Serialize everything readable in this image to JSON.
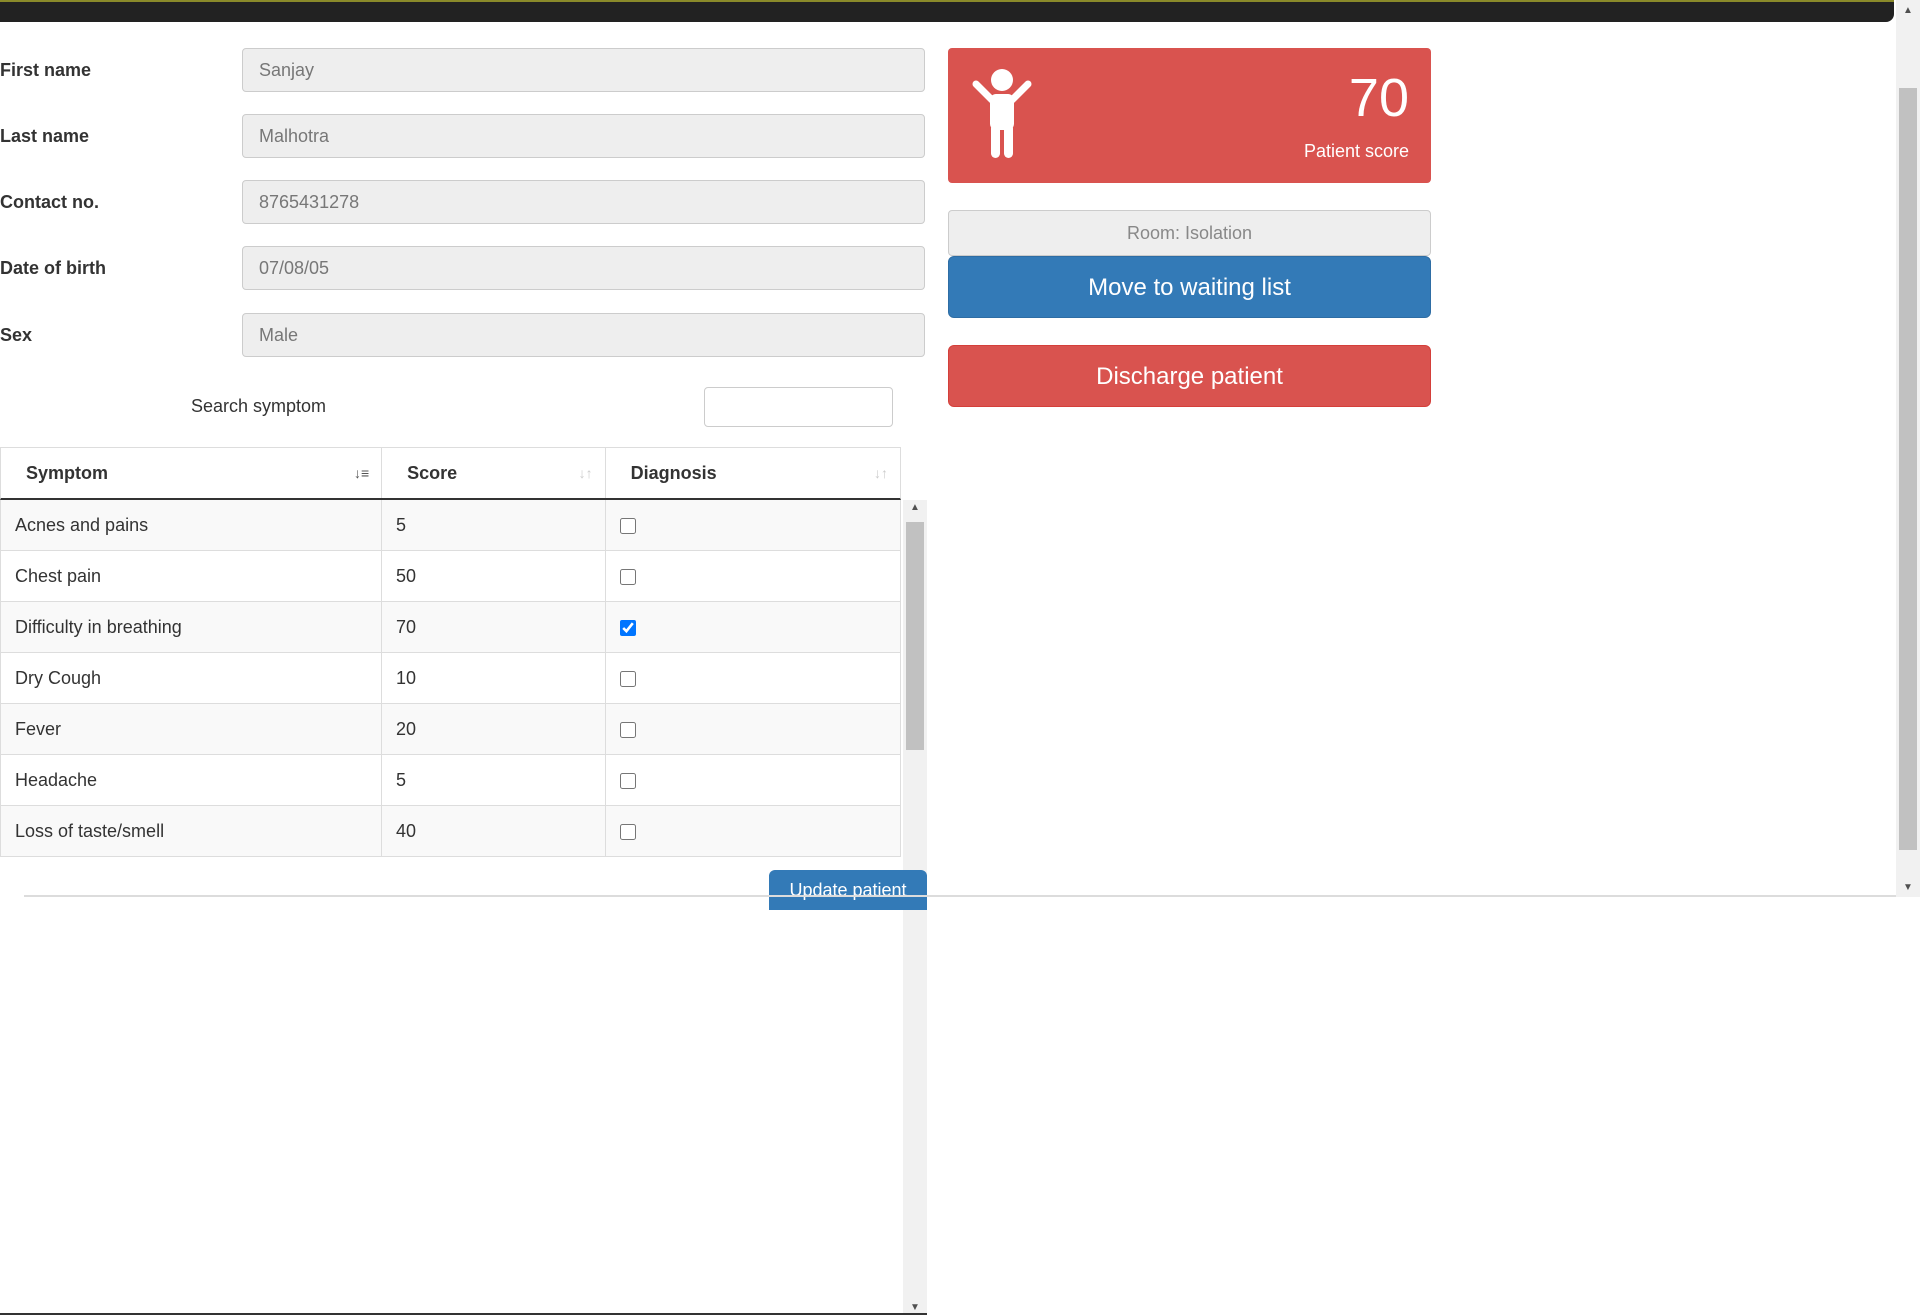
{
  "form": {
    "first_name": {
      "label": "First name",
      "value": "Sanjay"
    },
    "last_name": {
      "label": "Last name",
      "value": "Malhotra"
    },
    "contact": {
      "label": "Contact no.",
      "value": "8765431278"
    },
    "dob": {
      "label": "Date of birth",
      "value": "07/08/05"
    },
    "sex": {
      "label": "Sex",
      "value": "Male"
    }
  },
  "search": {
    "label": "Search symptom",
    "value": ""
  },
  "table": {
    "headers": [
      "Symptom",
      "Score",
      "Diagnosis"
    ],
    "sort_active_column": "Symptom",
    "rows": [
      {
        "symptom": "Acnes and pains",
        "score": "5",
        "diagnosis": false
      },
      {
        "symptom": "Chest pain",
        "score": "50",
        "diagnosis": false
      },
      {
        "symptom": "Difficulty in breathing",
        "score": "70",
        "diagnosis": true
      },
      {
        "symptom": "Dry Cough",
        "score": "10",
        "diagnosis": false
      },
      {
        "symptom": "Fever",
        "score": "20",
        "diagnosis": false
      },
      {
        "symptom": "Headache",
        "score": "5",
        "diagnosis": false
      },
      {
        "symptom": "Loss of taste/smell",
        "score": "40",
        "diagnosis": false
      }
    ]
  },
  "update_button": "Update patient",
  "score_panel": {
    "value": "70",
    "label": "Patient score",
    "icon": "child-icon",
    "color": "#d9534f"
  },
  "room": "Room: Isolation",
  "actions": {
    "waiting": "Move to waiting list",
    "discharge": "Discharge patient"
  },
  "colors": {
    "primary": "#337ab7",
    "danger": "#d9534f"
  }
}
